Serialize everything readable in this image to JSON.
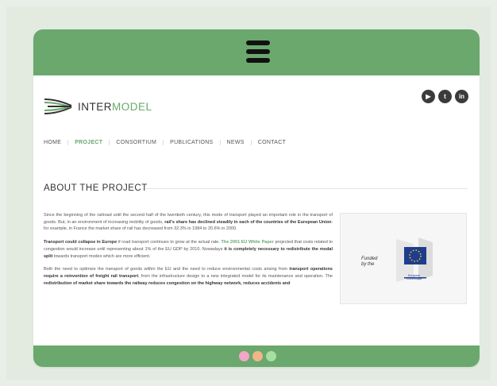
{
  "logo": {
    "text_dark": "INTER",
    "text_accent": "MODEL"
  },
  "social": [
    {
      "icon": "youtube-icon",
      "glyph": "▶"
    },
    {
      "icon": "twitter-icon",
      "glyph": "t"
    },
    {
      "icon": "linkedin-icon",
      "glyph": "in"
    }
  ],
  "nav": [
    "HOME",
    "PROJECT",
    "CONSORTIUM",
    "PUBLICATIONS",
    "NEWS",
    "CONTACT"
  ],
  "nav_active": "PROJECT",
  "section_title": "ABOUT THE PROJECT",
  "paragraphs": {
    "p1_a": "Since the beginning of the railroad until the second half of the twentieth century, this mode of transport played an important role in the transport of goods. But, in an environment of increasing mobility of goods,",
    "p1_b": "rail's share has declined steadily in each of the countries of the European Union",
    "p1_c": ": for example, in France the market share of rail has decreased from 32.3% in 1984 to 20.6% in 2000.",
    "p2_a": "Transport could collapse in Europe",
    "p2_b": " if road transport continues to grow at the actual rate.",
    "p2_c": "The 2001 EU White Paper",
    "p2_d": " projected that costs related to congestion would increase until representing about 1% of the EU GDP by 2010. Nowadays",
    "p2_e": "it is completely necessary to redistribute the modal split",
    "p2_f": " towards transport modes which are more efficient.",
    "p3_a": "Both the need to optimize the transport of goods within the EU and the need to reduce environmental costs arising from",
    "p3_b": "transport operations require a reinvention of freight rail transport",
    "p3_c": ", from the infrastructure design to a new integrated model for its maintenance and operation. The",
    "p3_d": "redistribution of market share towards the railway reduces congestion on the highway network, reduces accidents and",
    "p3_e": ""
  },
  "funding": {
    "line1": "Funded",
    "line2": "by the",
    "eu_label1": "European",
    "eu_label2": "Commission"
  },
  "dots_colors": [
    "#f2a6c8",
    "#f2b48a",
    "#a7dfa0"
  ],
  "colors": {
    "brand_green": "#6aa86d",
    "background": "#e9efe7"
  }
}
